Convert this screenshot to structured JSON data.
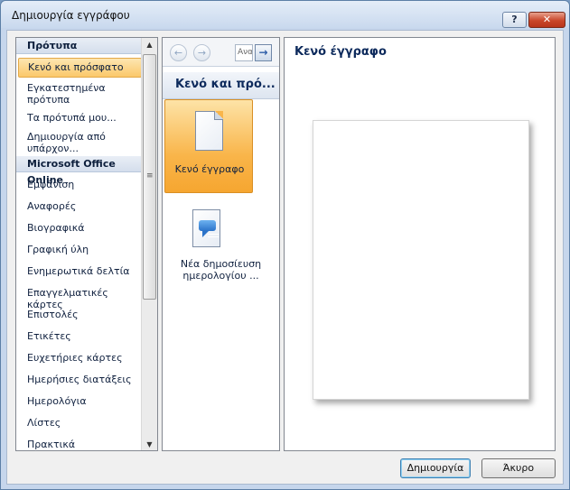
{
  "window": {
    "title": "Δημιουργία εγγράφου",
    "help_label": "?",
    "close_label": "✕"
  },
  "left_pane": {
    "section_templates": "Πρότυπα",
    "items_local": [
      {
        "label": "Κενό και πρόσφατο",
        "selected": true
      },
      {
        "label": "Εγκατεστημένα πρότυπα"
      },
      {
        "label": "Τα πρότυπά μου..."
      },
      {
        "label": "Δημιουργία από υπάρχον..."
      }
    ],
    "section_online": "Microsoft Office Online",
    "items_online": [
      "Εμφάνιση",
      "Αναφορές",
      "Βιογραφικά",
      "Γραφική ύλη",
      "Ενημερωτικά δελτία",
      "Επαγγελματικές κάρτες",
      "Επιστολές",
      "Ετικέτες",
      "Ευχετήριες κάρτες",
      "Ημερήσιες διατάξεις",
      "Ημερολόγια",
      "Λίστες",
      "Πρακτικά"
    ]
  },
  "middle_pane": {
    "search_value": "Αναζ",
    "header": "Κενό και πρό...",
    "templates": [
      {
        "label": "Κενό έγγραφο",
        "icon": "blank-document-icon",
        "selected": true
      },
      {
        "label": "Νέα δημοσίευση ημερολογίου ...",
        "icon": "blog-post-icon"
      }
    ]
  },
  "right_pane": {
    "preview_title": "Κενό έγγραφο"
  },
  "buttons": {
    "create": "Δημιουργία",
    "cancel": "Άκυρο"
  }
}
